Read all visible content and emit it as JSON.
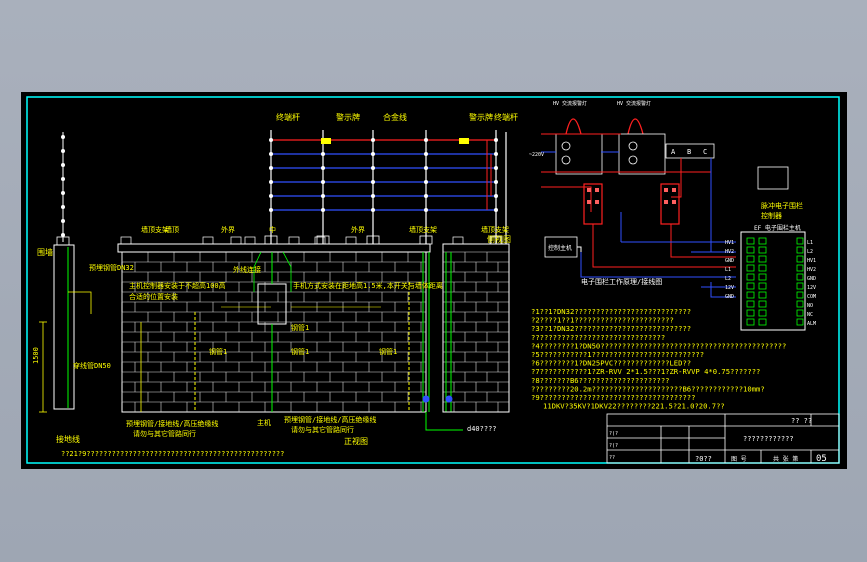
{
  "colors": {
    "frame": "#00ffff",
    "wall": "#ffffff",
    "hot": "#ff2020",
    "wire": "#3050ff",
    "note": "#ffff00",
    "panel": "#00ff00",
    "dim": "#ff40ff"
  },
  "fence": {
    "labels": {
      "pole_left": "终端杆",
      "sign_left": "警示牌",
      "fence_wire": "合金线",
      "sign_right": "警示牌",
      "pole_right": "终端杆"
    },
    "left_labels": {
      "wall": "围墙",
      "pipe": "预埋钢管DN32",
      "ground": "接地线",
      "pipe_v": "穿线管DN50",
      "height": "1500"
    },
    "top_row": [
      "墙顶支架",
      "墙顶",
      "外界",
      "中",
      "外界",
      "墙顶支架",
      "墙顶支架"
    ],
    "callouts": {
      "a": "主机控制器安装于不超高100高",
      "b": "合适的位置安装",
      "c": "手机方式安装在距地高1.5米,本开关与墙体距离",
      "d": "钢管1",
      "e": "钢管1",
      "f": "钢管1",
      "g": "钢管1",
      "h": "外线连接",
      "i": "d40????"
    },
    "bottom_labels": {
      "a": "预埋钢管/接地线/高压绝缘线",
      "b": "请勿与其它管路同行",
      "c": "主机",
      "d": "预埋钢管/接地线/高压绝缘线",
      "e": "请勿与其它管路同行",
      "f": "正视图",
      "g": "侧视图"
    },
    "note": "??21?9???????????????????????????????????????????????",
    "dim_h": "1500"
  },
  "schematic": {
    "lamp_labels": [
      "HV 交流报警灯",
      "HV 交流报警灯"
    ],
    "terminal_top": [
      "A",
      "B",
      "C"
    ],
    "caption": "电子围栏工作原理/接线图",
    "pwr": "~220V",
    "host": "控制主机",
    "switch_labels": [
      "HV1",
      "HV2",
      "GND",
      "L1",
      "L2",
      "12V",
      "GND"
    ]
  },
  "legend": {
    "title": "脉冲电子围栏",
    "subtitle": "控制器",
    "box_title": "EF 电子围栏主机",
    "pins": [
      "L1",
      "L2",
      "HV1",
      "HV2",
      "GND",
      "12V",
      "COM",
      "NO",
      "NC",
      "ALM"
    ]
  },
  "notes": [
    "?1??1?DN32???????????????????????????",
    "?2????1??1???????????????????????",
    "?3??1?DN32???????????????????????????",
    "???????????????????????????????",
    "?4????????1?DN50???????????????????????????????????????????",
    "?5???????????1??????????????????????????",
    "?6????????1?DN25PVC?????????????LED??",
    "?7???????????1?ZR-RVV 2*1.5???1?ZR-RVVP 4*0.75???????",
    "?8???????B6?????????????????????",
    "?????????20.2m?????????????????????B6????????????10mm?",
    "?9????????????????????????????????????",
    "11DKV?35KV?1DKV22????????221.5?21.0?20.7??"
  ],
  "title_block": {
    "scale": "??  ??",
    "drawing_name": "????????????",
    "rows": [
      "?(?",
      "?(?",
      "??",
      "??"
    ],
    "date": "?0??",
    "sheet_label": "图 号",
    "page_label": "共 张 第",
    "sheet_no": "05"
  }
}
